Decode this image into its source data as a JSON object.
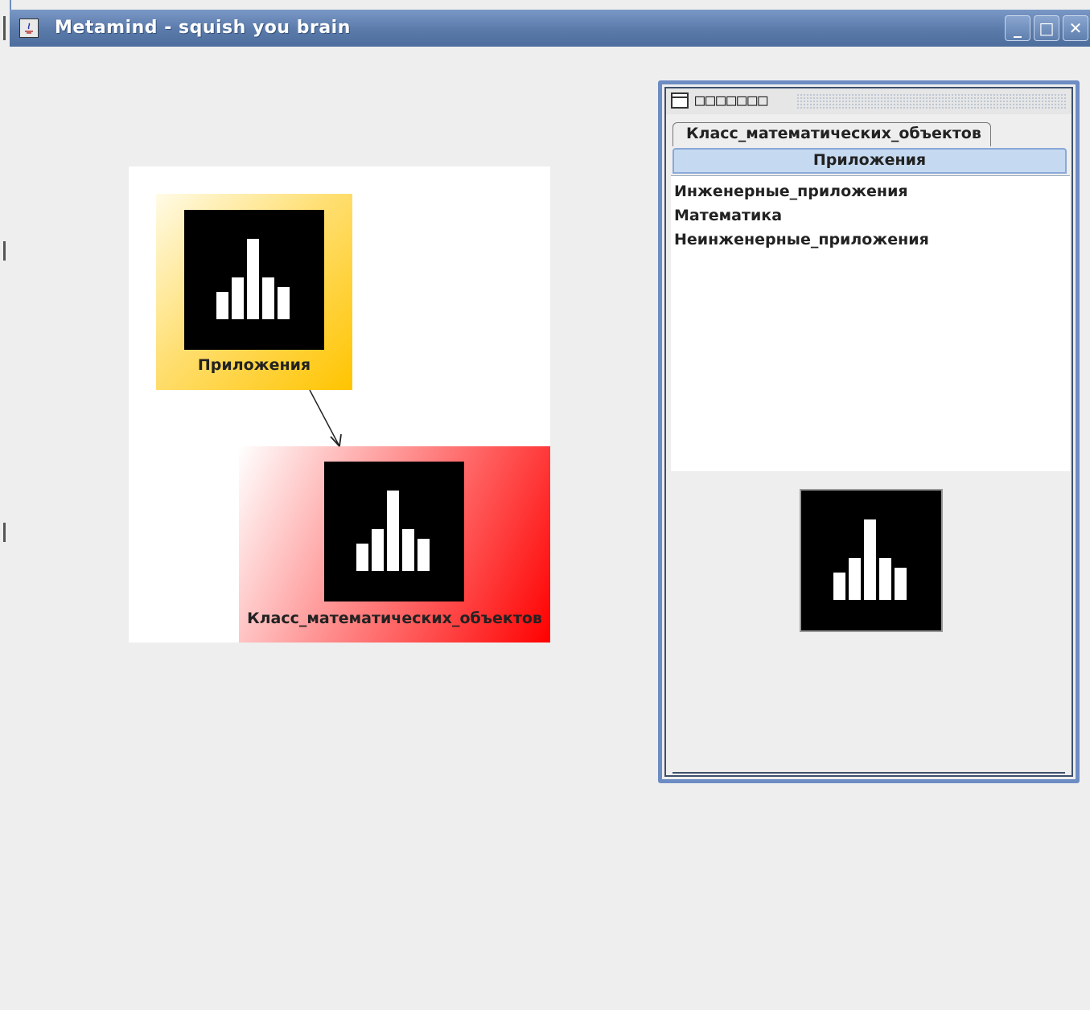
{
  "window": {
    "title": "Metamind - squish you brain",
    "controls": {
      "minimize": "_",
      "maximize": "□",
      "close": "✕"
    }
  },
  "graph": {
    "nodes": [
      {
        "id": "apps",
        "label": "Приложения",
        "icon": "bar-chart-icon",
        "color": "#ffc400"
      },
      {
        "id": "class",
        "label": "Класс_математических_объектов",
        "icon": "bar-chart-icon",
        "color": "#ff0000"
      }
    ],
    "edges": [
      {
        "from": "apps",
        "to": "class"
      }
    ]
  },
  "inspector": {
    "title": "□□□□□□□",
    "tabs": [
      {
        "label": "Класс_математических_объектов",
        "selected": false
      },
      {
        "label": "Приложения",
        "selected": true
      }
    ],
    "items": [
      "Инженерные_приложения",
      "Математика",
      "Неинженерные_приложения"
    ],
    "preview_icon": "bar-chart-icon"
  },
  "colors": {
    "titlebar": "#5a7aaa",
    "frame_border": "#6d8cc4",
    "selected_tab": "#c5d9f0"
  }
}
